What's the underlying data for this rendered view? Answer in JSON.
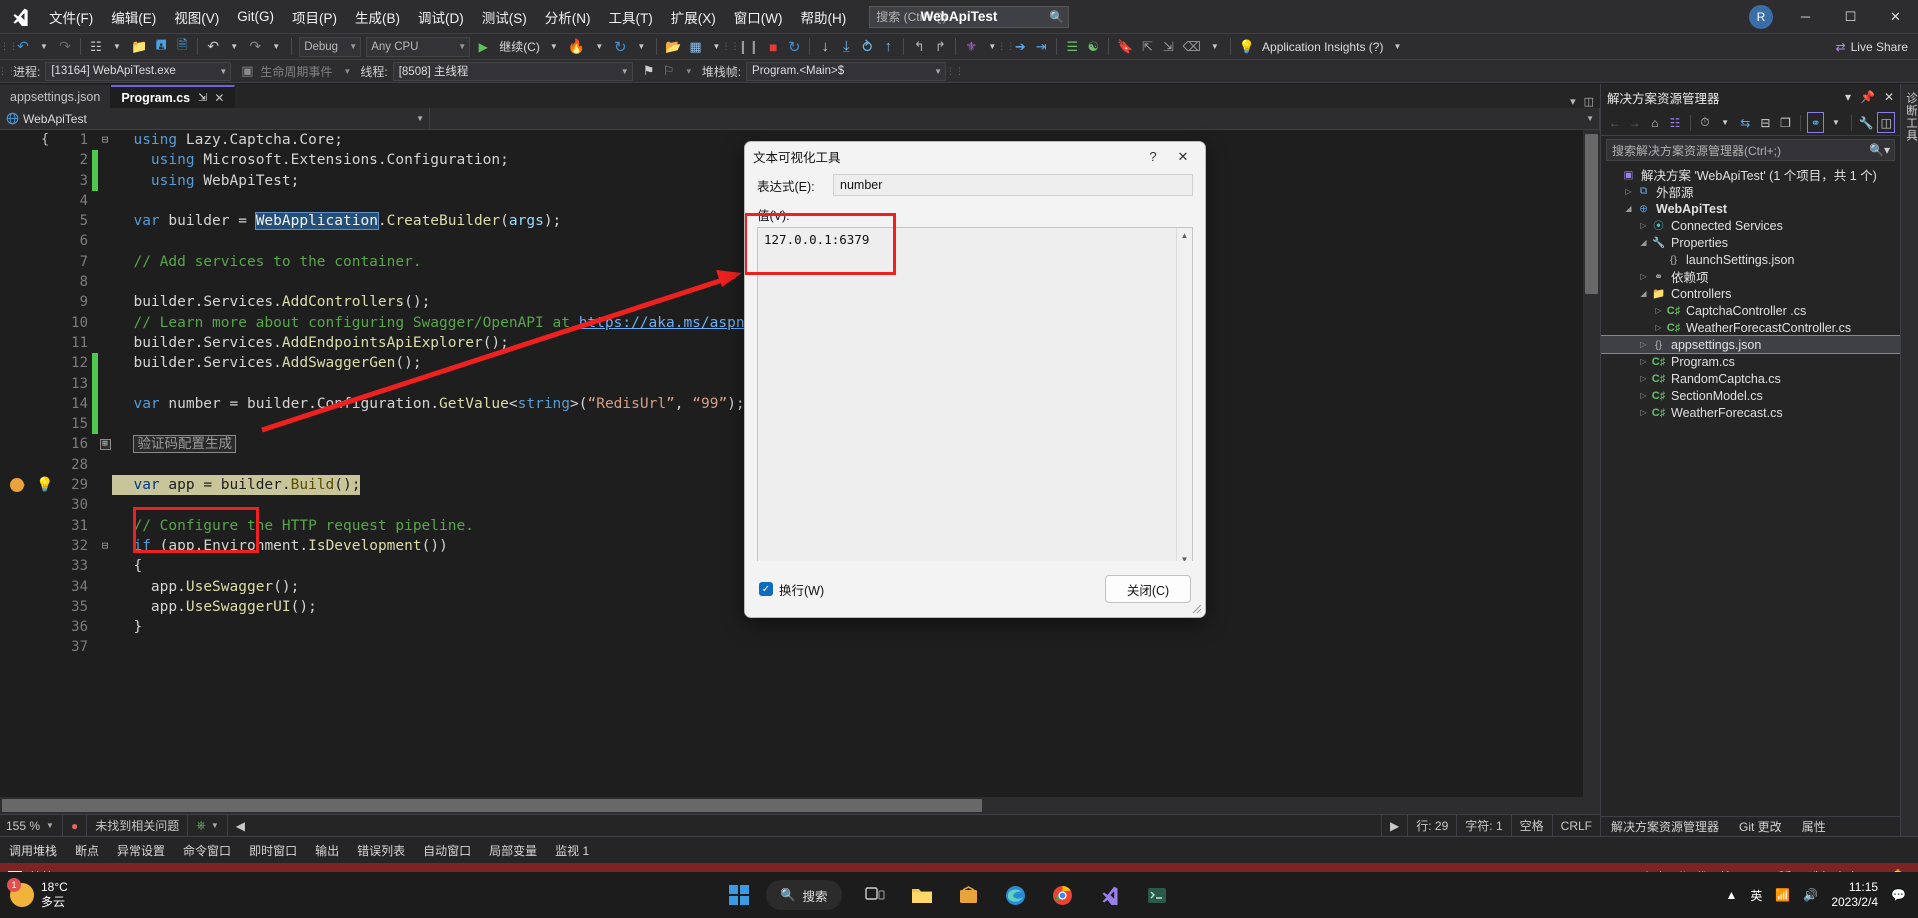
{
  "window": {
    "title": "WebApiTest",
    "account_initial": "R",
    "live_share": "Live Share",
    "minimize": "─",
    "maximize": "☐",
    "close": "✕"
  },
  "menu": {
    "items": [
      {
        "label": "文件(F)"
      },
      {
        "label": "编辑(E)"
      },
      {
        "label": "视图(V)"
      },
      {
        "label": "Git(G)"
      },
      {
        "label": "项目(P)"
      },
      {
        "label": "生成(B)"
      },
      {
        "label": "调试(D)"
      },
      {
        "label": "测试(S)"
      },
      {
        "label": "分析(N)"
      },
      {
        "label": "工具(T)"
      },
      {
        "label": "扩展(X)"
      },
      {
        "label": "窗口(W)"
      },
      {
        "label": "帮助(H)"
      }
    ],
    "search_placeholder": "搜索 (Ctrl+Q)"
  },
  "toolbar": {
    "config": "Debug",
    "platform": "Any CPU",
    "continue_label": "继续(C)",
    "app_insights": "Application Insights (?)"
  },
  "debugbar": {
    "process_label": "进程:",
    "process_value": "[13164] WebApiTest.exe",
    "lifecycle_label": "生命周期事件",
    "thread_label": "线程:",
    "thread_value": "[8508] 主线程",
    "stackframe_label": "堆栈帧:",
    "stackframe_value": "Program.<Main>$"
  },
  "tabs": [
    {
      "label": "appsettings.json",
      "active": false
    },
    {
      "label": "Program.cs",
      "active": true,
      "pin": "⇲",
      "close": "✕"
    }
  ],
  "navbar": {
    "project": "WebApiTest",
    "member": ""
  },
  "code": {
    "lines": [
      {
        "num": "1",
        "changed": false,
        "fold": "⊟",
        "tokens": [
          {
            "t": "using ",
            "c": "k"
          },
          {
            "t": "Lazy",
            "c": "id"
          },
          {
            "t": ".",
            "c": "id"
          },
          {
            "t": "Captcha",
            "c": "id"
          },
          {
            "t": ".",
            "c": "id"
          },
          {
            "t": "Core",
            "c": "id"
          },
          {
            "t": ";",
            "c": "id"
          }
        ]
      },
      {
        "num": "2",
        "changed": true,
        "indent": 1,
        "tokens": [
          {
            "t": "using ",
            "c": "k"
          },
          {
            "t": "Microsoft.Extensions.Configuration;",
            "c": "id"
          }
        ]
      },
      {
        "num": "3",
        "changed": true,
        "indent": 1,
        "tokens": [
          {
            "t": "using ",
            "c": "k"
          },
          {
            "t": "WebApiTest;",
            "c": "id"
          }
        ]
      },
      {
        "num": "4",
        "changed": false,
        "tokens": []
      },
      {
        "num": "5",
        "changed": false,
        "tokens": [
          {
            "t": "var ",
            "c": "k"
          },
          {
            "t": "builder ",
            "c": "id"
          },
          {
            "t": "= ",
            "c": "id"
          },
          {
            "t": "WebApplication",
            "c": "sel"
          },
          {
            "t": ".",
            "c": "id"
          },
          {
            "t": "CreateBuilder",
            "c": "mth"
          },
          {
            "t": "(",
            "c": "id"
          },
          {
            "t": "args",
            "c": "pm"
          },
          {
            "t": ");",
            "c": "id"
          }
        ]
      },
      {
        "num": "6",
        "changed": false,
        "tokens": []
      },
      {
        "num": "7",
        "changed": false,
        "tokens": [
          {
            "t": "// Add services to the container.",
            "c": "cm"
          }
        ]
      },
      {
        "num": "8",
        "changed": false,
        "tokens": []
      },
      {
        "num": "9",
        "changed": false,
        "tokens": [
          {
            "t": "builder",
            "c": "id"
          },
          {
            "t": ".",
            "c": "id"
          },
          {
            "t": "Services",
            "c": "id"
          },
          {
            "t": ".",
            "c": "id"
          },
          {
            "t": "AddControllers",
            "c": "mth"
          },
          {
            "t": "();",
            "c": "id"
          }
        ]
      },
      {
        "num": "10",
        "changed": false,
        "tokens": [
          {
            "t": "// Learn more about configuring Swagger/OpenAPI at ",
            "c": "cm"
          },
          {
            "t": "https://aka.ms/aspnetco",
            "c": "lnk"
          }
        ]
      },
      {
        "num": "11",
        "changed": false,
        "tokens": [
          {
            "t": "builder",
            "c": "id"
          },
          {
            "t": ".",
            "c": "id"
          },
          {
            "t": "Services",
            "c": "id"
          },
          {
            "t": ".",
            "c": "id"
          },
          {
            "t": "AddEndpointsApiExplorer",
            "c": "mth"
          },
          {
            "t": "();",
            "c": "id"
          }
        ]
      },
      {
        "num": "12",
        "changed": true,
        "tokens": [
          {
            "t": "builder",
            "c": "id"
          },
          {
            "t": ".",
            "c": "id"
          },
          {
            "t": "Services",
            "c": "id"
          },
          {
            "t": ".",
            "c": "id"
          },
          {
            "t": "AddSwaggerGen",
            "c": "mth"
          },
          {
            "t": "();",
            "c": "id"
          }
        ]
      },
      {
        "num": "13",
        "changed": true,
        "tokens": []
      },
      {
        "num": "14",
        "changed": true,
        "tokens": [
          {
            "t": "var ",
            "c": "k"
          },
          {
            "t": "number ",
            "c": "id"
          },
          {
            "t": "= ",
            "c": "id"
          },
          {
            "t": "builder",
            "c": "id"
          },
          {
            "t": ".",
            "c": "id"
          },
          {
            "t": "Configuration",
            "c": "id"
          },
          {
            "t": ".",
            "c": "id"
          },
          {
            "t": "GetValue",
            "c": "mth"
          },
          {
            "t": "<",
            "c": "id"
          },
          {
            "t": "string",
            "c": "k"
          },
          {
            "t": ">(",
            "c": "id"
          },
          {
            "t": "“RedisUrl”",
            "c": "st"
          },
          {
            "t": ", ",
            "c": "id"
          },
          {
            "t": "“99”",
            "c": "st"
          },
          {
            "t": ");//",
            "c": "id"
          }
        ]
      },
      {
        "num": "15",
        "changed": true,
        "tokens": []
      },
      {
        "num": "16",
        "changed": false,
        "collapsed": "验证码配置生成",
        "foldbox": "⊞",
        "tokens": []
      },
      {
        "num": "28",
        "changed": false,
        "tokens": []
      },
      {
        "num": "29",
        "changed": false,
        "breakpoint": true,
        "bulb": true,
        "highlight": true,
        "tokens": [
          {
            "t": "var ",
            "c": "k"
          },
          {
            "t": "app ",
            "c": "id"
          },
          {
            "t": "= ",
            "c": "id"
          },
          {
            "t": "builder",
            "c": "id"
          },
          {
            "t": ".",
            "c": "id"
          },
          {
            "t": "Build",
            "c": "mth"
          },
          {
            "t": "();",
            "c": "id"
          }
        ]
      },
      {
        "num": "30",
        "changed": false,
        "tokens": []
      },
      {
        "num": "31",
        "changed": false,
        "tokens": [
          {
            "t": "// Configure the HTTP request pipeline.",
            "c": "cm"
          }
        ]
      },
      {
        "num": "32",
        "changed": false,
        "fold": "⊟",
        "tokens": [
          {
            "t": "if ",
            "c": "k"
          },
          {
            "t": "(",
            "c": "id"
          },
          {
            "t": "app",
            "c": "id"
          },
          {
            "t": ".",
            "c": "id"
          },
          {
            "t": "Environment",
            "c": "id"
          },
          {
            "t": ".",
            "c": "id"
          },
          {
            "t": "IsDevelopment",
            "c": "mth"
          },
          {
            "t": "())",
            "c": "id"
          }
        ]
      },
      {
        "num": "33",
        "changed": false,
        "tokens": [
          {
            "t": "{",
            "c": "id"
          }
        ]
      },
      {
        "num": "34",
        "changed": false,
        "indent": 1,
        "tokens": [
          {
            "t": "app",
            "c": "id"
          },
          {
            "t": ".",
            "c": "id"
          },
          {
            "t": "UseSwagger",
            "c": "mth"
          },
          {
            "t": "();",
            "c": "id"
          }
        ]
      },
      {
        "num": "35",
        "changed": false,
        "indent": 1,
        "tokens": [
          {
            "t": "app",
            "c": "id"
          },
          {
            "t": ".",
            "c": "id"
          },
          {
            "t": "UseSwaggerUI",
            "c": "mth"
          },
          {
            "t": "();",
            "c": "id"
          }
        ]
      },
      {
        "num": "36",
        "changed": false,
        "tokens": [
          {
            "t": "}",
            "c": "id"
          }
        ]
      },
      {
        "num": "37",
        "changed": false,
        "tokens": []
      }
    ]
  },
  "editor_status": {
    "zoom": "155 %",
    "issues": "未找到相关问题",
    "line": "行: 29",
    "col": "字符: 1",
    "spaces": "空格",
    "eol": "CRLF"
  },
  "solution_explorer": {
    "title": "解决方案资源管理器",
    "search_placeholder": "搜索解决方案资源管理器(Ctrl+;)",
    "tree": [
      {
        "depth": 0,
        "twisty": "",
        "icon": "solution-icon",
        "label": "解决方案 'WebApiTest' (1 个项目，共 1 个)",
        "bold": false
      },
      {
        "depth": 1,
        "twisty": "▷",
        "icon": "external-icon",
        "label": "外部源",
        "bold": false
      },
      {
        "depth": 1,
        "twisty": "◢",
        "icon": "project-icon",
        "label": "WebApiTest",
        "bold": true
      },
      {
        "depth": 2,
        "twisty": "▷",
        "icon": "connected-icon",
        "label": "Connected Services",
        "bold": false
      },
      {
        "depth": 2,
        "twisty": "◢",
        "icon": "props-icon",
        "label": "Properties",
        "bold": false
      },
      {
        "depth": 3,
        "twisty": "",
        "icon": "json-icon",
        "label": "launchSettings.json",
        "bold": false
      },
      {
        "depth": 2,
        "twisty": "▷",
        "icon": "deps-icon",
        "label": "依赖项",
        "bold": false
      },
      {
        "depth": 2,
        "twisty": "◢",
        "icon": "folder-icon",
        "label": "Controllers",
        "bold": false
      },
      {
        "depth": 3,
        "twisty": "▷",
        "icon": "cs-icon",
        "label": "CaptchaController .cs",
        "bold": false
      },
      {
        "depth": 3,
        "twisty": "▷",
        "icon": "cs-icon",
        "label": "WeatherForecastController.cs",
        "bold": false
      },
      {
        "depth": 2,
        "twisty": "▷",
        "icon": "json-icon",
        "label": "appsettings.json",
        "bold": false,
        "selected": true
      },
      {
        "depth": 2,
        "twisty": "▷",
        "icon": "cs-icon",
        "label": "Program.cs",
        "bold": false
      },
      {
        "depth": 2,
        "twisty": "▷",
        "icon": "cs-icon",
        "label": "RandomCaptcha.cs",
        "bold": false
      },
      {
        "depth": 2,
        "twisty": "▷",
        "icon": "cs-icon",
        "label": "SectionModel.cs",
        "bold": false
      },
      {
        "depth": 2,
        "twisty": "▷",
        "icon": "cs-icon",
        "label": "WeatherForecast.cs",
        "bold": false
      }
    ],
    "status_tabs": [
      "解决方案资源管理器",
      "Git 更改",
      "属性"
    ],
    "vertical_strip": "诊断工具"
  },
  "bottom_dock": {
    "tabs": [
      "调用堆栈",
      "断点",
      "异常设置",
      "命令窗口",
      "即时窗口",
      "输出",
      "错误列表",
      "自动窗口",
      "局部变量",
      "监视 1"
    ]
  },
  "vs_status": {
    "ready": "就绪",
    "add_source": "添加到源代码管理 ▲",
    "select_repo": "选择仓库 ▲"
  },
  "dialog": {
    "title": "文本可视化工具",
    "help": "?",
    "close": "✕",
    "expression_label": "表达式(E):",
    "expression_value": "number",
    "value_label": "值(V):",
    "value_text": "127.0.0.1:6379",
    "wrap_label": "换行(W)",
    "wrap_checked": true,
    "close_button": "关闭(C)"
  },
  "taskbar": {
    "weather_temp": "18°C",
    "weather_desc": "多云",
    "weather_badge": "1",
    "search_label": "搜索",
    "time": "11:15",
    "date": "2023/2/4",
    "ime": "英"
  },
  "colors": {
    "accent_purple": "#7160e8",
    "status_red": "#7c2424",
    "annotation_red": "#ef2020",
    "keyword_blue": "#569cd6",
    "comment_green": "#57a64a",
    "string_brown": "#d69d85",
    "method_yellow": "#dcdcaa",
    "highlight_olive": "#c8c59a"
  }
}
